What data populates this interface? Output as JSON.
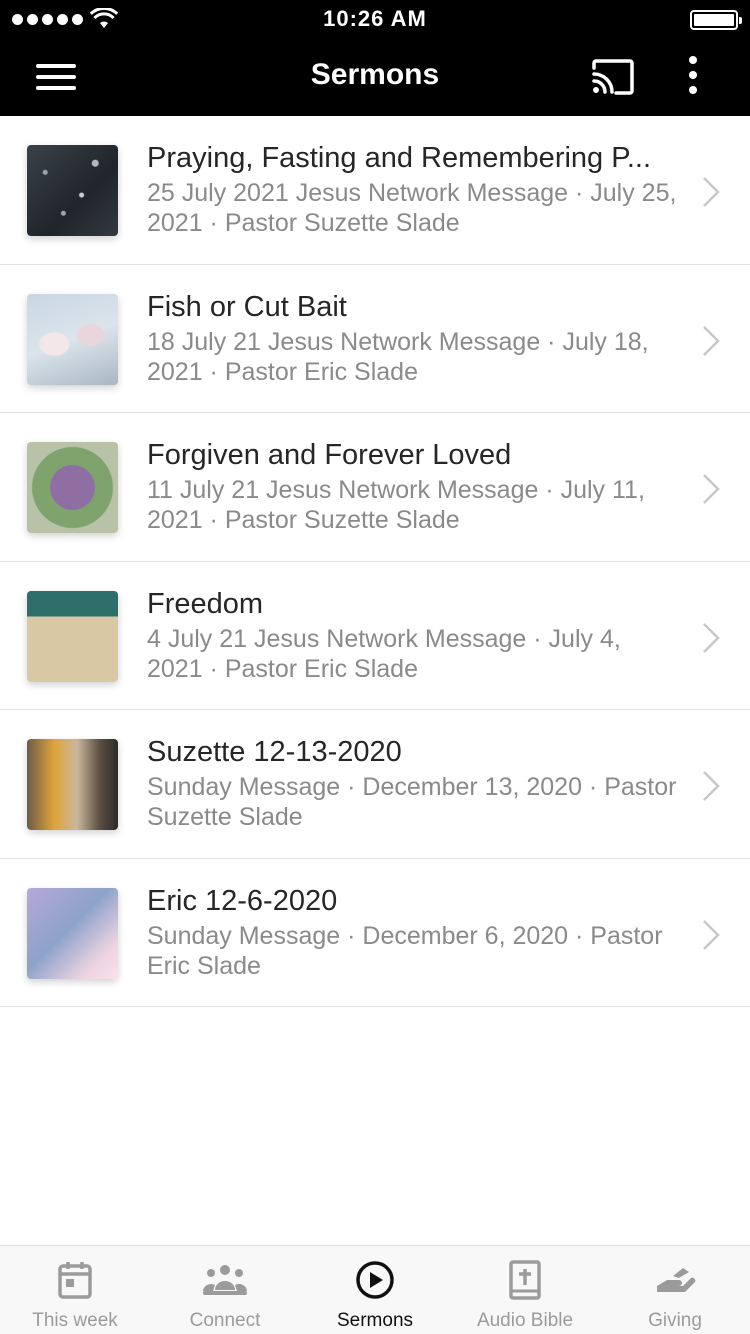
{
  "status_bar": {
    "time": "10:26 AM"
  },
  "header": {
    "title": "Sermons",
    "icons": [
      "menu-icon",
      "cast-icon",
      "more-vertical-icon"
    ]
  },
  "sermons": [
    {
      "title": "Praying, Fasting and Remembering P...",
      "subtitle": "25 July 2021 Jesus Network Message · July 25, 2021 · Pastor Suzette Slade",
      "thumbnail": "snow-dark-thumbnail"
    },
    {
      "title": "Fish or Cut Bait",
      "subtitle": "18 July 21 Jesus Network Message · July 18, 2021 · Pastor Eric Slade",
      "thumbnail": "magnolia-thumbnail"
    },
    {
      "title": "Forgiven and Forever Loved",
      "subtitle": "11 July 21 Jesus Network Message · July 11, 2021 · Pastor Suzette Slade",
      "thumbnail": "tulip-bouquet-thumbnail"
    },
    {
      "title": "Freedom",
      "subtitle": "4 July 21 Jesus Network Message · July 4, 2021 · Pastor Eric Slade",
      "thumbnail": "typewriter-thumbnail"
    },
    {
      "title": "Suzette 12-13-2020",
      "subtitle": "Sunday Message · December 13, 2020 · Pastor Suzette Slade",
      "thumbnail": "train-platform-thumbnail"
    },
    {
      "title": "Eric 12-6-2020",
      "subtitle": "Sunday Message · December 6, 2020 · Pastor Eric Slade",
      "thumbnail": "pastel-sky-thumbnail"
    }
  ],
  "tabs": [
    {
      "label": "This week",
      "icon": "calendar-icon",
      "active": false
    },
    {
      "label": "Connect",
      "icon": "people-icon",
      "active": false
    },
    {
      "label": "Sermons",
      "icon": "play-circle-icon",
      "active": true
    },
    {
      "label": "Audio Bible",
      "icon": "bible-icon",
      "active": false
    },
    {
      "label": "Giving",
      "icon": "giving-hand-icon",
      "active": false
    }
  ],
  "colors": {
    "header_bg": "#000000",
    "tab_active": "#111111",
    "tab_inactive": "#9b9b9b",
    "subtitle": "#8a8a8a"
  }
}
